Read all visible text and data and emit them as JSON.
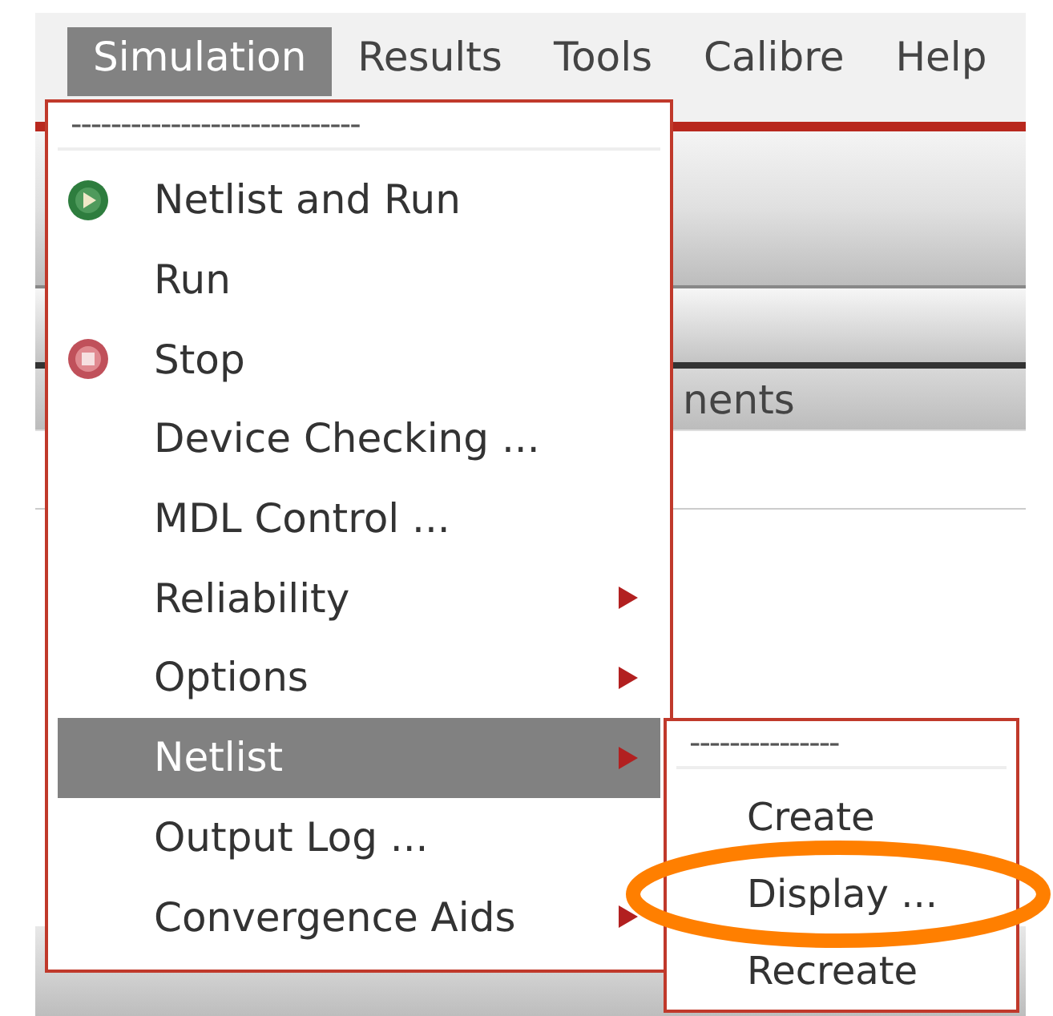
{
  "menu_bar": [
    {
      "label": "Simulation",
      "selected": true
    },
    {
      "label": "Results",
      "selected": false
    },
    {
      "label": "Tools",
      "selected": false
    },
    {
      "label": "Calibre",
      "selected": false
    },
    {
      "label": "Help",
      "selected": false
    }
  ],
  "background": {
    "column_header": "nents"
  },
  "simulation_menu": {
    "tear_off": "-----------------------------",
    "items": [
      {
        "label": "Netlist and Run",
        "kind": "play",
        "submenu": false,
        "selected": false
      },
      {
        "label": "Run",
        "kind": "plain",
        "submenu": false,
        "selected": false
      },
      {
        "label": "Stop",
        "kind": "stop",
        "submenu": false,
        "selected": false
      },
      {
        "label": "Device Checking ...",
        "kind": "plain",
        "submenu": false,
        "selected": false
      },
      {
        "label": "MDL Control ...",
        "kind": "plain",
        "submenu": false,
        "selected": false
      },
      {
        "label": "Reliability",
        "kind": "plain",
        "submenu": true,
        "selected": false
      },
      {
        "label": "Options",
        "kind": "plain",
        "submenu": true,
        "selected": false
      },
      {
        "label": "Netlist",
        "kind": "plain",
        "submenu": true,
        "selected": true
      },
      {
        "label": "Output Log ...",
        "kind": "plain",
        "submenu": false,
        "selected": false
      },
      {
        "label": "Convergence Aids",
        "kind": "plain",
        "submenu": true,
        "selected": false
      }
    ]
  },
  "netlist_submenu": {
    "tear_off": "---------------",
    "items": [
      {
        "label": "Create",
        "selected": false
      },
      {
        "label": "Display ...",
        "selected": false
      },
      {
        "label": "Recreate",
        "selected": false
      }
    ]
  },
  "annotations": [
    {
      "kind": "ellipse"
    }
  ]
}
